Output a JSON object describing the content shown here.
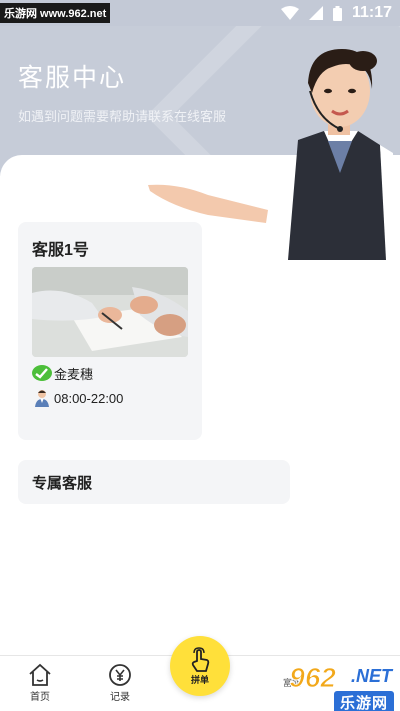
{
  "status_bar": {
    "watermark": "乐游网 www.962.net",
    "time": "11:17"
  },
  "hero": {
    "title": "客服中心",
    "subtitle": "如遇到问题需要帮助请联系在线客服"
  },
  "service_card": {
    "title": "客服1号",
    "wechat": "金麦穗",
    "hours": "08:00-22:00"
  },
  "exclusive": {
    "label": "专属客服"
  },
  "tabbar": {
    "home": "首页",
    "record": "记录",
    "center": "拼单",
    "right_partial": "富能"
  },
  "watermark_br": {
    "num": "962",
    "net": ".NET",
    "text": "乐游网"
  },
  "colors": {
    "hero_bg": "#c6ccd8",
    "accent_yellow": "#ffe03a",
    "wechat_green": "#4cbf3a"
  },
  "icons": [
    "wifi-icon",
    "signal-icon",
    "battery-icon",
    "home-icon",
    "yen-icon",
    "tap-hand-icon",
    "wechat-icon",
    "agent-icon"
  ]
}
